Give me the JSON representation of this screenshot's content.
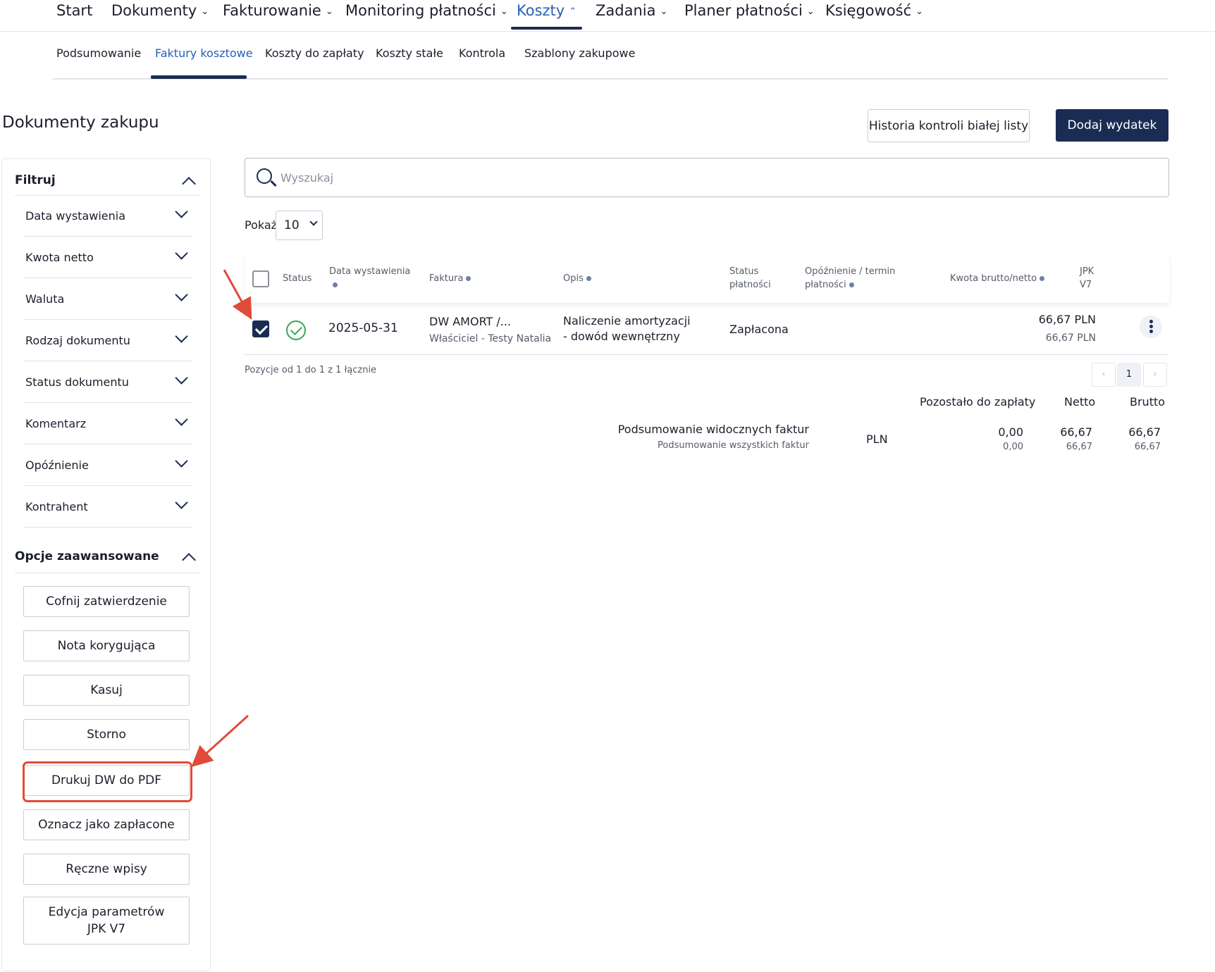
{
  "topnav": {
    "items": [
      {
        "label": "Start",
        "chevron": ""
      },
      {
        "label": "Dokumenty",
        "chevron": "⌄"
      },
      {
        "label": "Fakturowanie",
        "chevron": "⌄"
      },
      {
        "label": "Monitoring płatności",
        "chevron": "⌄"
      },
      {
        "label": "Koszty",
        "chevron": "⌃"
      },
      {
        "label": "Zadania",
        "chevron": "⌄"
      },
      {
        "label": "Planer płatności",
        "chevron": "⌄"
      },
      {
        "label": "Księgowość",
        "chevron": "⌄"
      }
    ]
  },
  "subnav": {
    "items": [
      {
        "label": "Podsumowanie"
      },
      {
        "label": "Faktury kosztowe"
      },
      {
        "label": "Koszty do zapłaty"
      },
      {
        "label": "Koszty stałe"
      },
      {
        "label": "Kontrola"
      },
      {
        "label": "Szablony zakupowe"
      }
    ]
  },
  "page": {
    "title": "Dokumenty zakupu",
    "history_button": "Historia kontroli białej listy",
    "add_button": "Dodaj wydatek"
  },
  "filters": {
    "header": "Filtruj",
    "items": [
      {
        "label": "Data wystawienia"
      },
      {
        "label": "Kwota netto"
      },
      {
        "label": "Waluta"
      },
      {
        "label": "Rodzaj dokumentu"
      },
      {
        "label": "Status dokumentu"
      },
      {
        "label": "Komentarz"
      },
      {
        "label": "Opóźnienie"
      },
      {
        "label": "Kontrahent"
      }
    ]
  },
  "advanced": {
    "header": "Opcje zaawansowane",
    "buttons": [
      {
        "label": "Cofnij zatwierdzenie"
      },
      {
        "label": "Nota korygująca"
      },
      {
        "label": "Kasuj"
      },
      {
        "label": "Storno"
      },
      {
        "label": "Drukuj DW do PDF"
      },
      {
        "label": "Oznacz jako zapłacone"
      },
      {
        "label": "Ręczne wpisy"
      },
      {
        "label": "Edycja parametrów JPK V7"
      }
    ]
  },
  "search": {
    "placeholder": "Wyszukaj"
  },
  "show": {
    "label": "Pokaż",
    "value": "10"
  },
  "table": {
    "headers": {
      "status": "Status",
      "date": "Data wystawienia",
      "invoice": "Faktura",
      "description": "Opis",
      "payment_status_1": "Status",
      "payment_status_2": "płatności",
      "delay_1": "Opóźnienie / termin",
      "delay_2": "płatności",
      "amount": "Kwota brutto/netto",
      "jpk_1": "JPK",
      "jpk_2": "V7"
    },
    "rows": [
      {
        "checked": true,
        "status_icon": "check-circle-icon",
        "date": "2025-05-31",
        "invoice": "DW AMORT /...",
        "invoice_sub": "Właściciel - Testy Natalia",
        "description_1": "Naliczenie amortyzacji",
        "description_2": "- dowód wewnętrzny",
        "payment_status": "Zapłacona",
        "gross": "66,67 PLN",
        "net": "66,67 PLN"
      }
    ]
  },
  "pagination": {
    "info": "Pozycje od 1 do 1 z 1 łącznie",
    "prev": "‹",
    "page": "1",
    "next": "›"
  },
  "summary": {
    "headers": {
      "remaining": "Pozostało do zapłaty",
      "net": "Netto",
      "gross": "Brutto"
    },
    "visible_label": "Podsumowanie widocznych faktur",
    "all_label": "Podsumowanie wszystkich faktur",
    "currency": "PLN",
    "visible": {
      "remaining": "0,00",
      "net": "66,67",
      "gross": "66,67"
    },
    "all": {
      "remaining": "0,00",
      "net": "66,67",
      "gross": "66,67"
    }
  },
  "colors": {
    "navy": "#1b2c54",
    "active_link": "#2860b8",
    "annotation": "#e04b3a",
    "success": "#3aa655"
  }
}
